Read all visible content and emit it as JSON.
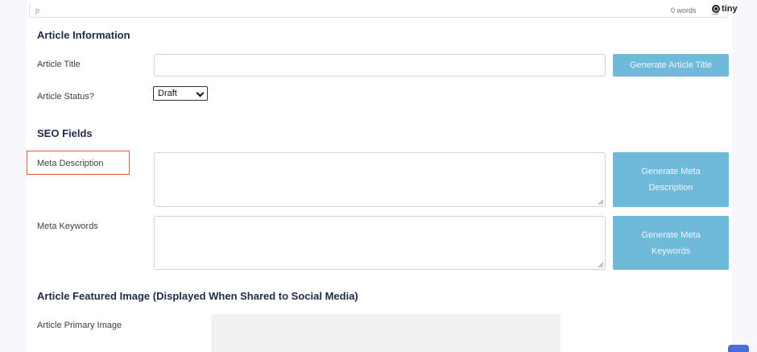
{
  "editor_status": {
    "path": "p",
    "word_count": "0 words",
    "brand": "tiny"
  },
  "sections": {
    "article_information": "Article Information",
    "seo_fields": "SEO Fields",
    "featured_image": "Article Featured Image (Displayed When Shared to Social Media)"
  },
  "article_title": {
    "label": "Article Title",
    "value": "",
    "button": "Generate Article Title"
  },
  "article_status": {
    "label": "Article Status?",
    "selected": "Draft"
  },
  "meta_description": {
    "label": "Meta Description",
    "value": "",
    "button": "Generate Meta Description"
  },
  "meta_keywords": {
    "label": "Meta Keywords",
    "value": "",
    "button": "Generate Meta Keywords"
  },
  "primary_image": {
    "label": "Article Primary Image"
  },
  "colors": {
    "button_bg": "#6fbadb",
    "highlight_border": "#e4573a",
    "heading": "#1f2b4d"
  }
}
